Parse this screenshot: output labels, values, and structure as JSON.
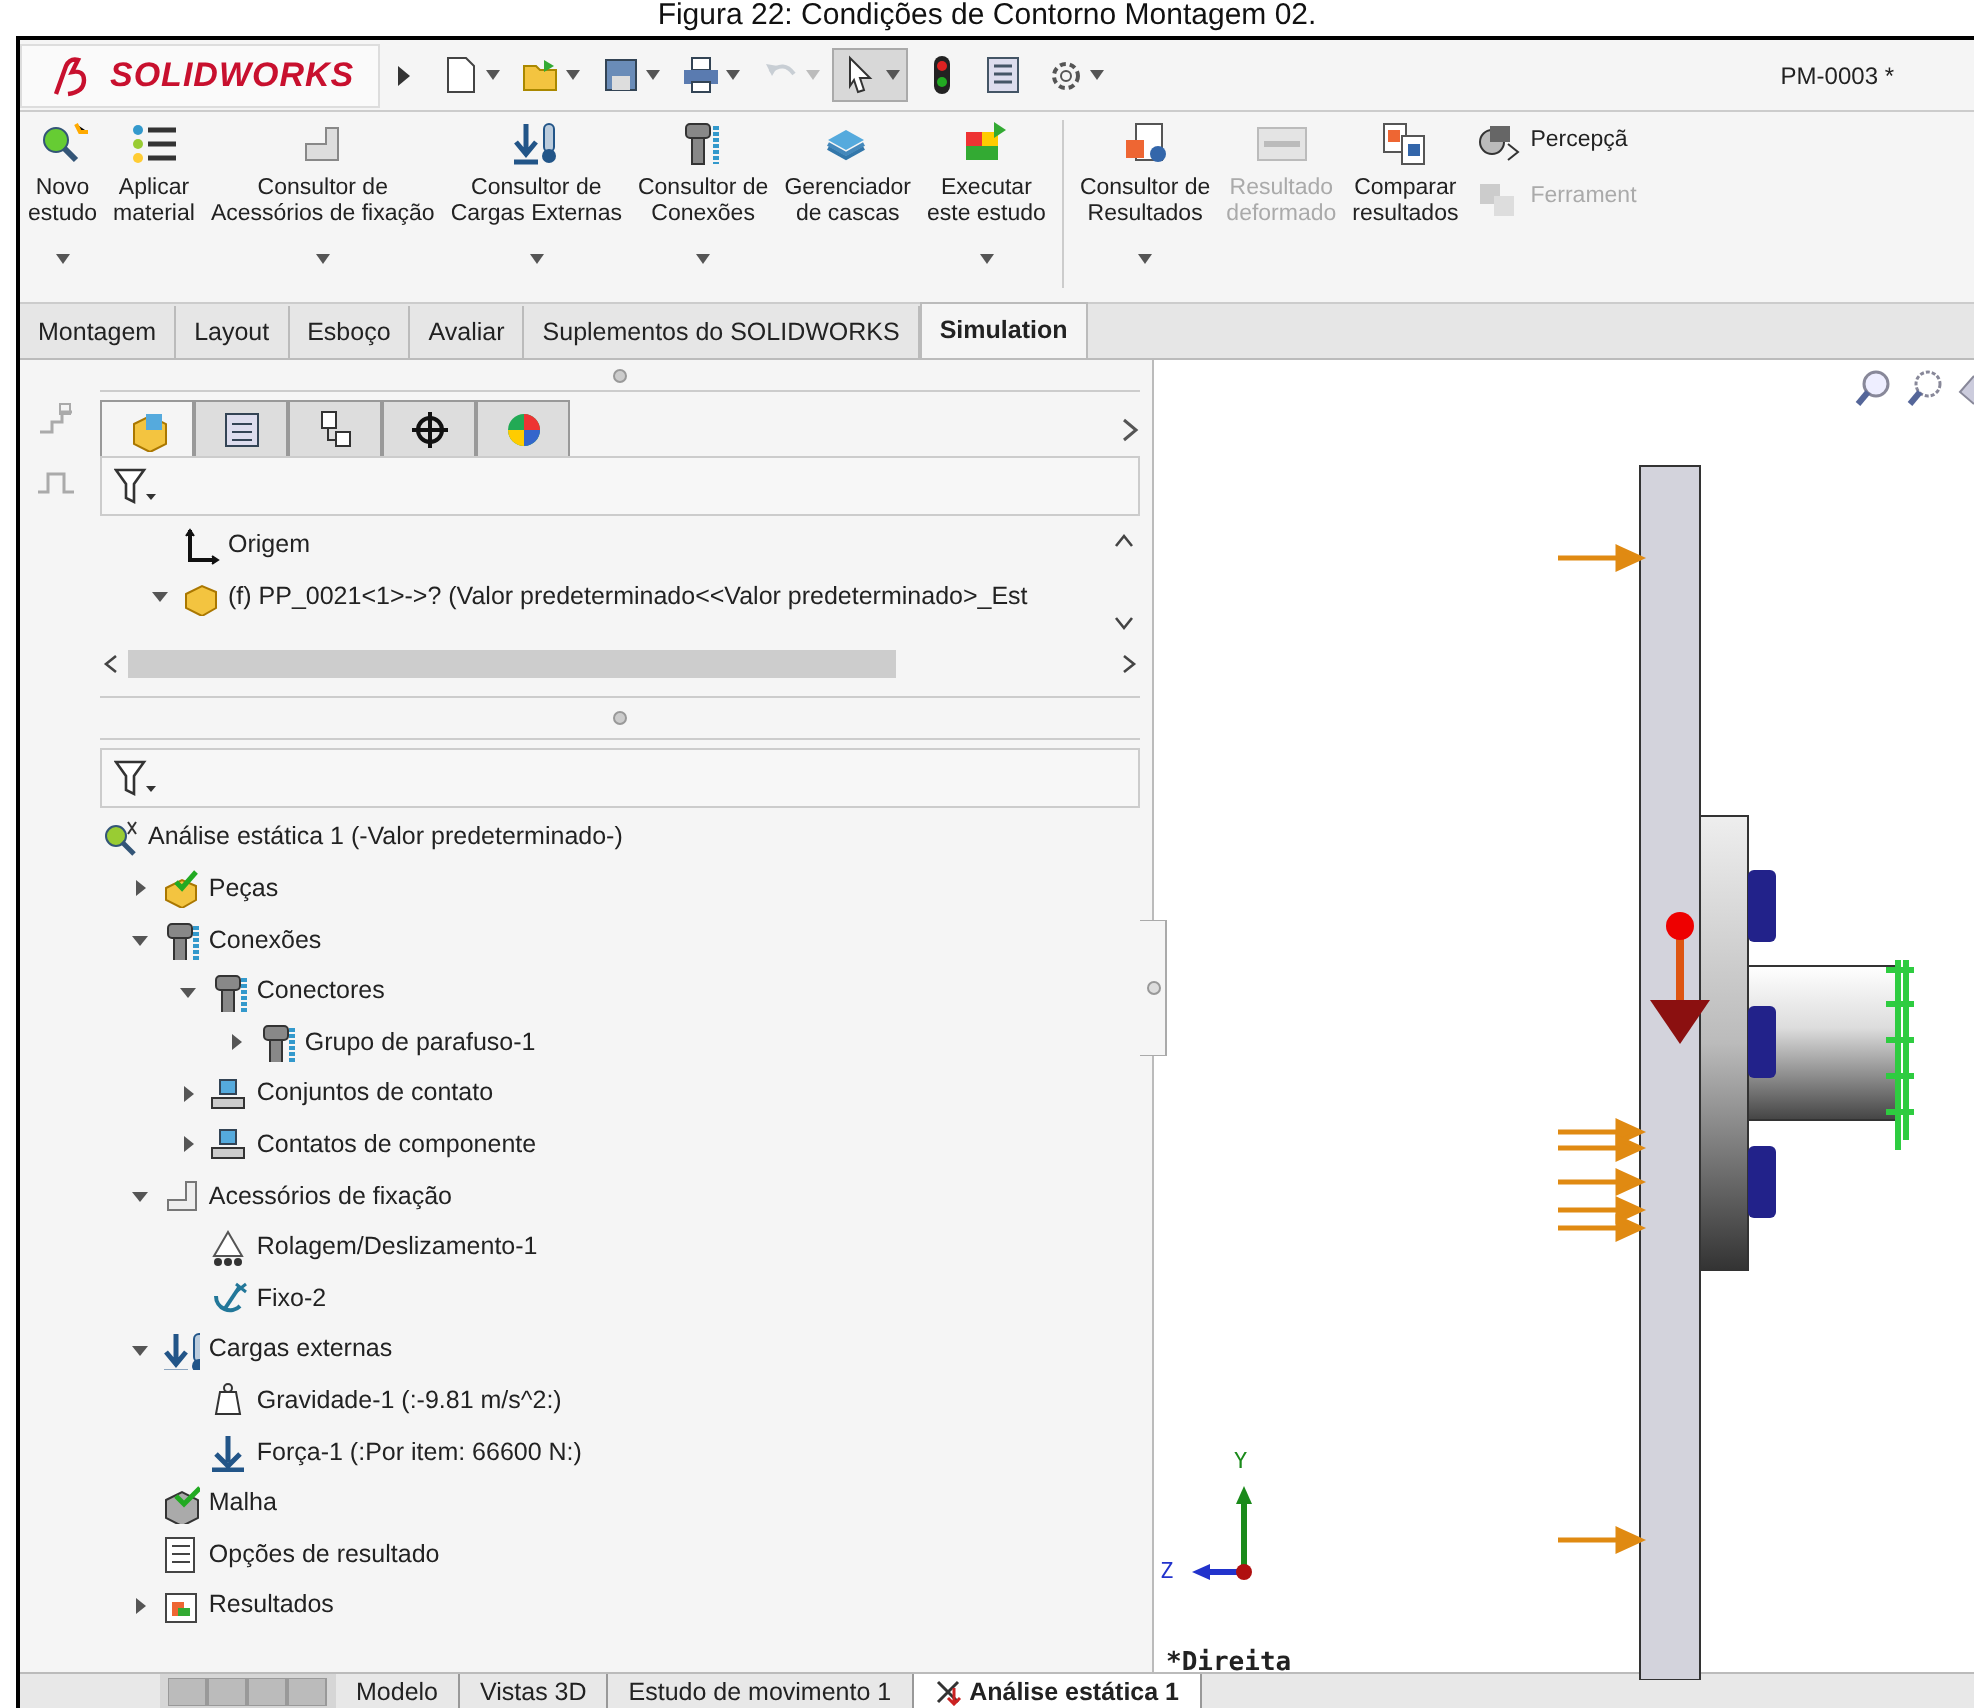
{
  "caption": "Figura 22: Condições de Contorno Montagem 02.",
  "title_bar": {
    "logo": "SOLIDWORKS",
    "document": "PM-0003 *",
    "quick_access": [
      {
        "kind": "new",
        "dropdown": true,
        "disabled": false,
        "pressed": false
      },
      {
        "kind": "open",
        "dropdown": true,
        "disabled": false,
        "pressed": false
      },
      {
        "kind": "save",
        "dropdown": true,
        "disabled": false,
        "pressed": false
      },
      {
        "kind": "print",
        "dropdown": true,
        "disabled": false,
        "pressed": false
      },
      {
        "kind": "undo",
        "dropdown": true,
        "disabled": true,
        "pressed": false
      },
      {
        "kind": "select",
        "dropdown": true,
        "disabled": false,
        "pressed": true
      },
      {
        "kind": "traffic",
        "dropdown": false,
        "disabled": false,
        "pressed": false
      },
      {
        "kind": "list",
        "dropdown": false,
        "disabled": false,
        "pressed": false
      },
      {
        "kind": "gear",
        "dropdown": true,
        "disabled": false,
        "pressed": false
      }
    ]
  },
  "ribbon": [
    {
      "kind": "study",
      "label": "Novo\nestudo",
      "dropdown": true,
      "disabled": false
    },
    {
      "kind": "material",
      "label": "Aplicar\nmaterial",
      "dropdown": false,
      "disabled": false
    },
    {
      "kind": "fixture",
      "label": "Consultor de\nAcessórios de fixação",
      "dropdown": true,
      "disabled": false
    },
    {
      "kind": "load",
      "label": "Consultor de\nCargas Externas",
      "dropdown": true,
      "disabled": false
    },
    {
      "kind": "bolt",
      "label": "Consultor de\nConexões",
      "dropdown": true,
      "disabled": false
    },
    {
      "kind": "shell",
      "label": "Gerenciador\nde cascas",
      "dropdown": false,
      "disabled": false
    },
    {
      "kind": "run",
      "label": "Executar\neste estudo",
      "dropdown": true,
      "disabled": false
    },
    {
      "kind": "separator"
    },
    {
      "kind": "results",
      "label": "Consultor de\nResultados",
      "dropdown": true,
      "disabled": false
    },
    {
      "kind": "deformed",
      "label": "Resultado\ndeformado",
      "dropdown": false,
      "disabled": true
    },
    {
      "kind": "compare",
      "label": "Comparar\nresultados",
      "dropdown": false,
      "disabled": false
    },
    {
      "kind": "stack",
      "items": [
        {
          "kind": "insight",
          "label": "Percepçã",
          "disabled": false
        },
        {
          "kind": "tools",
          "label": "Ferrament",
          "disabled": true
        }
      ]
    }
  ],
  "command_tabs": [
    {
      "label": "Montagem",
      "selected": false
    },
    {
      "label": "Layout",
      "selected": false
    },
    {
      "label": "Esboço",
      "selected": false
    },
    {
      "label": "Avaliar",
      "selected": false
    },
    {
      "label": "Suplementos do SOLIDWORKS",
      "selected": false
    },
    {
      "label": "Simulation",
      "selected": true
    }
  ],
  "panel_tabs": [
    {
      "kind": "feature",
      "selected": true
    },
    {
      "kind": "property",
      "selected": false
    },
    {
      "kind": "config",
      "selected": false
    },
    {
      "kind": "dimxpert",
      "selected": false
    },
    {
      "kind": "appearance",
      "selected": false
    }
  ],
  "feature_tree": [
    {
      "kind": "origin",
      "label": "Origem"
    },
    {
      "kind": "part",
      "label": "(f) PP_0021<1>->? (Valor predeterminado<<Valor predeterminado>_Est",
      "expanded": true
    }
  ],
  "study_tree": {
    "kind": "study",
    "label": "Análise estática 1 (-Valor predeterminado-)",
    "children": [
      {
        "kind": "parts",
        "label": "Peças",
        "expanded": false
      },
      {
        "kind": "bolt",
        "label": "Conexões",
        "expanded": true,
        "children": [
          {
            "kind": "bolt",
            "label": "Conectores",
            "expanded": true,
            "children": [
              {
                "kind": "bolt",
                "label": "Grupo de parafuso-1",
                "expanded": false
              }
            ]
          },
          {
            "kind": "contact",
            "label": "Conjuntos de contato",
            "expanded": false
          },
          {
            "kind": "contact",
            "label": "Contatos de componente",
            "expanded": false
          }
        ]
      },
      {
        "kind": "fixture",
        "label": "Acessórios de fixação",
        "expanded": true,
        "children": [
          {
            "kind": "roller",
            "label": "Rolagem/Deslizamento-1"
          },
          {
            "kind": "fixed",
            "label": "Fixo-2"
          }
        ]
      },
      {
        "kind": "load",
        "label": "Cargas externas",
        "expanded": true,
        "children": [
          {
            "kind": "gravity",
            "label": "Gravidade-1 (:-9.81 m/s^2:)"
          },
          {
            "kind": "force",
            "label": "Força-1 (:Por item: 66600 N:)"
          }
        ]
      },
      {
        "kind": "mesh",
        "label": "Malha"
      },
      {
        "kind": "options",
        "label": "Opções de resultado"
      },
      {
        "kind": "resultsfolder",
        "label": "Resultados",
        "expanded": false
      }
    ]
  },
  "viewport": {
    "view_name": "*Direita",
    "axis_y": "Y",
    "axis_z": "Z"
  },
  "bottom_tabs": [
    {
      "label": "Modelo",
      "selected": false
    },
    {
      "label": "Vistas 3D",
      "selected": false
    },
    {
      "label": "Estudo de movimento 1",
      "selected": false
    },
    {
      "label": "Análise estática 1",
      "selected": true
    }
  ]
}
